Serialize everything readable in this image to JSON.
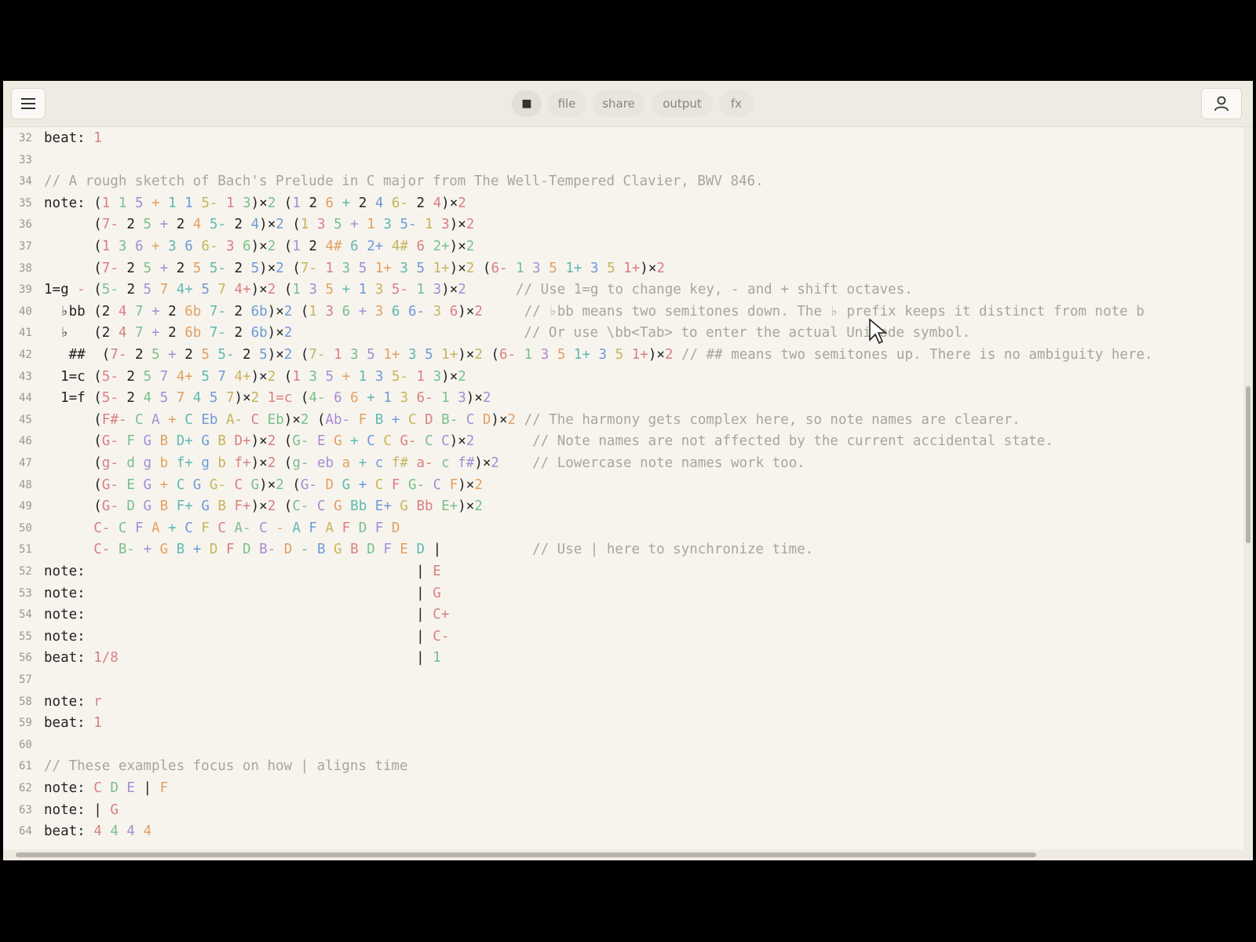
{
  "toolbar": {
    "menu_icon": "hamburger-menu-icon",
    "stop_icon": "stop-icon",
    "pills": [
      "file",
      "share",
      "output",
      "fx"
    ],
    "user_icon": "user-icon"
  },
  "editor": {
    "lines": [
      {
        "n": "32",
        "text": "beat: 1"
      },
      {
        "n": "33",
        "text": ""
      },
      {
        "n": "34",
        "text": "// A rough sketch of Bach's Prelude in C major from The Well-Tempered Clavier, BWV 846."
      },
      {
        "n": "35",
        "text": "note: (1 1 5 + 1 1 5- 1 3)×2 (1 2 6 + 2 4 6- 2 4)×2"
      },
      {
        "n": "36",
        "text": "      (7- 2 5 + 2 4 5- 2 4)×2 (1 3 5 + 1 3 5- 1 3)×2"
      },
      {
        "n": "37",
        "text": "      (1 3 6 + 3 6 6- 3 6)×2 (1 2 4# 6 2+ 4# 6 2+)×2"
      },
      {
        "n": "38",
        "text": "      (7- 2 5 + 2 5 5- 2 5)×2 (7- 1 3 5 1+ 3 5 1+)×2 (6- 1 3 5 1+ 3 5 1+)×2"
      },
      {
        "n": "39",
        "text": "1=g - (5- 2 5 7 4+ 5 7 4+)×2 (1 3 5 + 1 3 5- 1 3)×2      // Use 1=g to change key, - and + shift octaves."
      },
      {
        "n": "40",
        "text": "  ♭bb (2 4 7 + 2 6b 7- 2 6b)×2 (1 3 6 + 3 6 6- 3 6)×2     // ♭bb means two semitones down. The ♭ prefix keeps it distinct from note b"
      },
      {
        "n": "41",
        "text": "  ♭   (2 4 7 + 2 6b 7- 2 6b)×2                            // Or use \\bb<Tab> to enter the actual Unicode symbol."
      },
      {
        "n": "42",
        "text": "   ##  (7- 2 5 + 2 5 5- 2 5)×2 (7- 1 3 5 1+ 3 5 1+)×2 (6- 1 3 5 1+ 3 5 1+)×2 // ## means two semitones up. There is no ambiguity here."
      },
      {
        "n": "43",
        "text": "  1=c (5- 2 5 7 4+ 5 7 4+)×2 (1 3 5 + 1 3 5- 1 3)×2"
      },
      {
        "n": "44",
        "text": "  1=f (5- 2 4 5 7 4 5 7)×2 1=c (4- 6 6 + 1 3 6- 1 3)×2"
      },
      {
        "n": "45",
        "text": "      (F#- C A + C Eb A- C Eb)×2 (Ab- F B + C D B- C D)×2 // The harmony gets complex here, so note names are clearer."
      },
      {
        "n": "46",
        "text": "      (G- F G B D+ G B D+)×2 (G- E G + C C G- C C)×2       // Note names are not affected by the current accidental state."
      },
      {
        "n": "47",
        "text": "      (g- d g b f+ g b f+)×2 (g- eb a + c f# a- c f#)×2    // Lowercase note names work too."
      },
      {
        "n": "48",
        "text": "      (G- E G + C G G- C G)×2 (G- D G + C F G- C F)×2"
      },
      {
        "n": "49",
        "text": "      (G- D G B F+ G B F+)×2 (C- C G Bb E+ G Bb E+)×2"
      },
      {
        "n": "50",
        "text": "      C- C F A + C F C A- C - A F A F D F D"
      },
      {
        "n": "51",
        "text": "      C- B- + G B + D F D B- D - B G B D F E D |           // Use | here to synchronize time."
      },
      {
        "n": "52",
        "text": "note:                                        | E"
      },
      {
        "n": "53",
        "text": "note:                                        | G"
      },
      {
        "n": "54",
        "text": "note:                                        | C+"
      },
      {
        "n": "55",
        "text": "note:                                        | C-"
      },
      {
        "n": "56",
        "text": "beat: 1/8                                    | 1"
      },
      {
        "n": "57",
        "text": ""
      },
      {
        "n": "58",
        "text": "note: r"
      },
      {
        "n": "59",
        "text": "beat: 1"
      },
      {
        "n": "60",
        "text": ""
      },
      {
        "n": "61",
        "text": "// These examples focus on how | aligns time"
      },
      {
        "n": "62",
        "text": "note: C D E | F"
      },
      {
        "n": "63",
        "text": "note: | G"
      },
      {
        "n": "64",
        "text": "beat: 4 4 4 4"
      }
    ]
  },
  "cursor_icon": "mouse-pointer-icon"
}
